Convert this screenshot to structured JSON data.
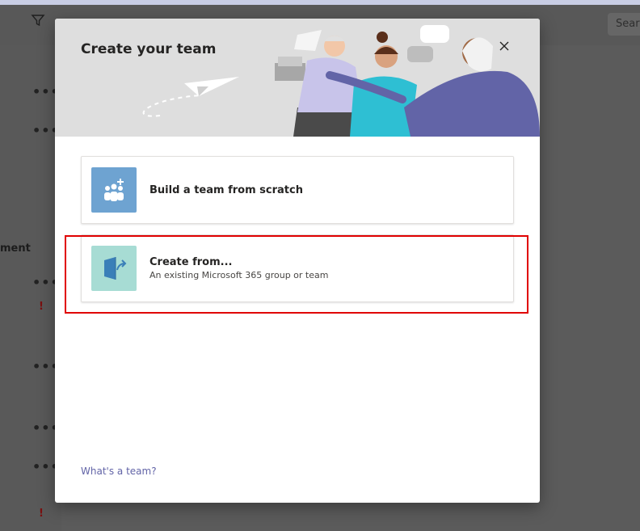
{
  "background": {
    "search_placeholder": "Search",
    "column_header": "ment",
    "more_glyph": "•••",
    "alert_glyph": "!"
  },
  "modal": {
    "title": "Create your team",
    "close_icon": "close-icon",
    "options": [
      {
        "title": "Build a team from scratch",
        "subtitle": "",
        "icon": "team-people-add-icon",
        "icon_bg": "#6ea3d1"
      },
      {
        "title": "Create from...",
        "subtitle": "An existing Microsoft 365 group or team",
        "icon": "create-from-existing-icon",
        "icon_bg": "#a7dcd4"
      }
    ],
    "help_link": "What's a team?"
  },
  "colors": {
    "accent": "#6264a7",
    "highlight": "#e00000",
    "overlay": "#5b5b5b"
  }
}
